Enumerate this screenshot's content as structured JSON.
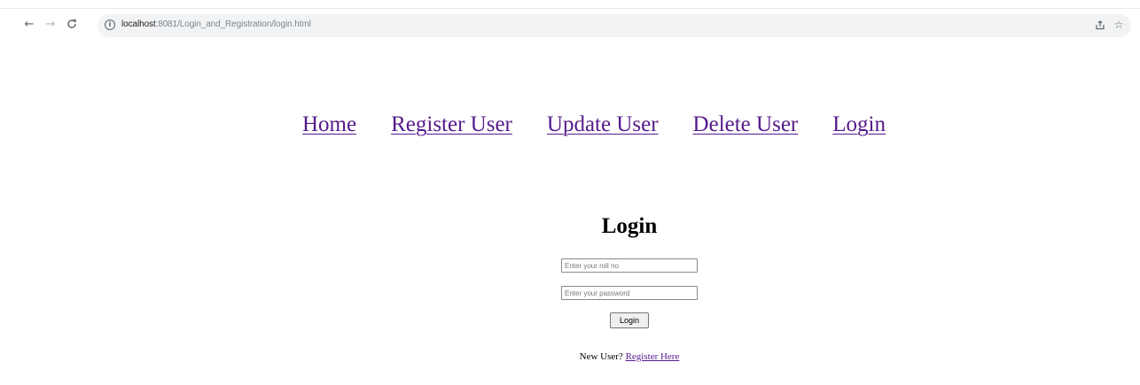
{
  "browser": {
    "url_host": "localhost",
    "url_path": ":8081/Login_and_Registration/login.html"
  },
  "nav": {
    "links": [
      "Home",
      "Register User",
      "Update User",
      "Delete User",
      "Login"
    ]
  },
  "login": {
    "title": "Login",
    "roll_placeholder": "Enter your roll no",
    "password_placeholder": "Enter your password",
    "submit_label": "Login",
    "new_user_text": "New User?",
    "register_link": "Register Here"
  },
  "colors": {
    "link": "#551a8b",
    "omnibox_bg": "#f1f3f4"
  }
}
